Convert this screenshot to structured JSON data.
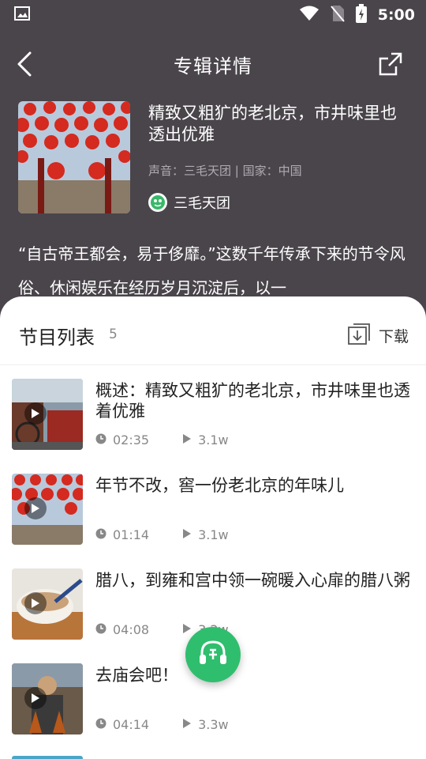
{
  "status": {
    "time": "5:00"
  },
  "header": {
    "title": "专辑详情"
  },
  "album": {
    "title": "精致又粗犷的老北京，市井味里也透出优雅",
    "meta": "声音：三毛天团 | 国家：中国",
    "author": "三毛天团",
    "description": "“自古帝王都会，易于侈靡。”这数千年传承下来的节令风俗、休闲娱乐在经历岁月沉淀后，以一"
  },
  "list": {
    "title": "节目列表",
    "count": "5",
    "download_label": "下载",
    "episodes": [
      {
        "title": "概述：精致又粗犷的老北京，市井味里也透着优雅",
        "duration": "02:35",
        "plays": "3.1w"
      },
      {
        "title": "年节不改，窖一份老北京的年味儿",
        "duration": "01:14",
        "plays": "3.1w"
      },
      {
        "title": "腊八，到雍和宫中领一碗暖入心扉的腊八粥",
        "duration": "04:08",
        "plays": "3.2w"
      },
      {
        "title": "去庙会吧！",
        "duration": "04:14",
        "plays": "3.3w"
      }
    ]
  },
  "colors": {
    "accent": "#2fbe6e",
    "header_bg": "#4a454b"
  },
  "icons": [
    "image-icon",
    "wifi-icon",
    "no-sim-icon",
    "battery-icon",
    "back-icon",
    "share-icon",
    "download-icon",
    "clock-icon",
    "play-icon",
    "player-headphone-icon"
  ]
}
